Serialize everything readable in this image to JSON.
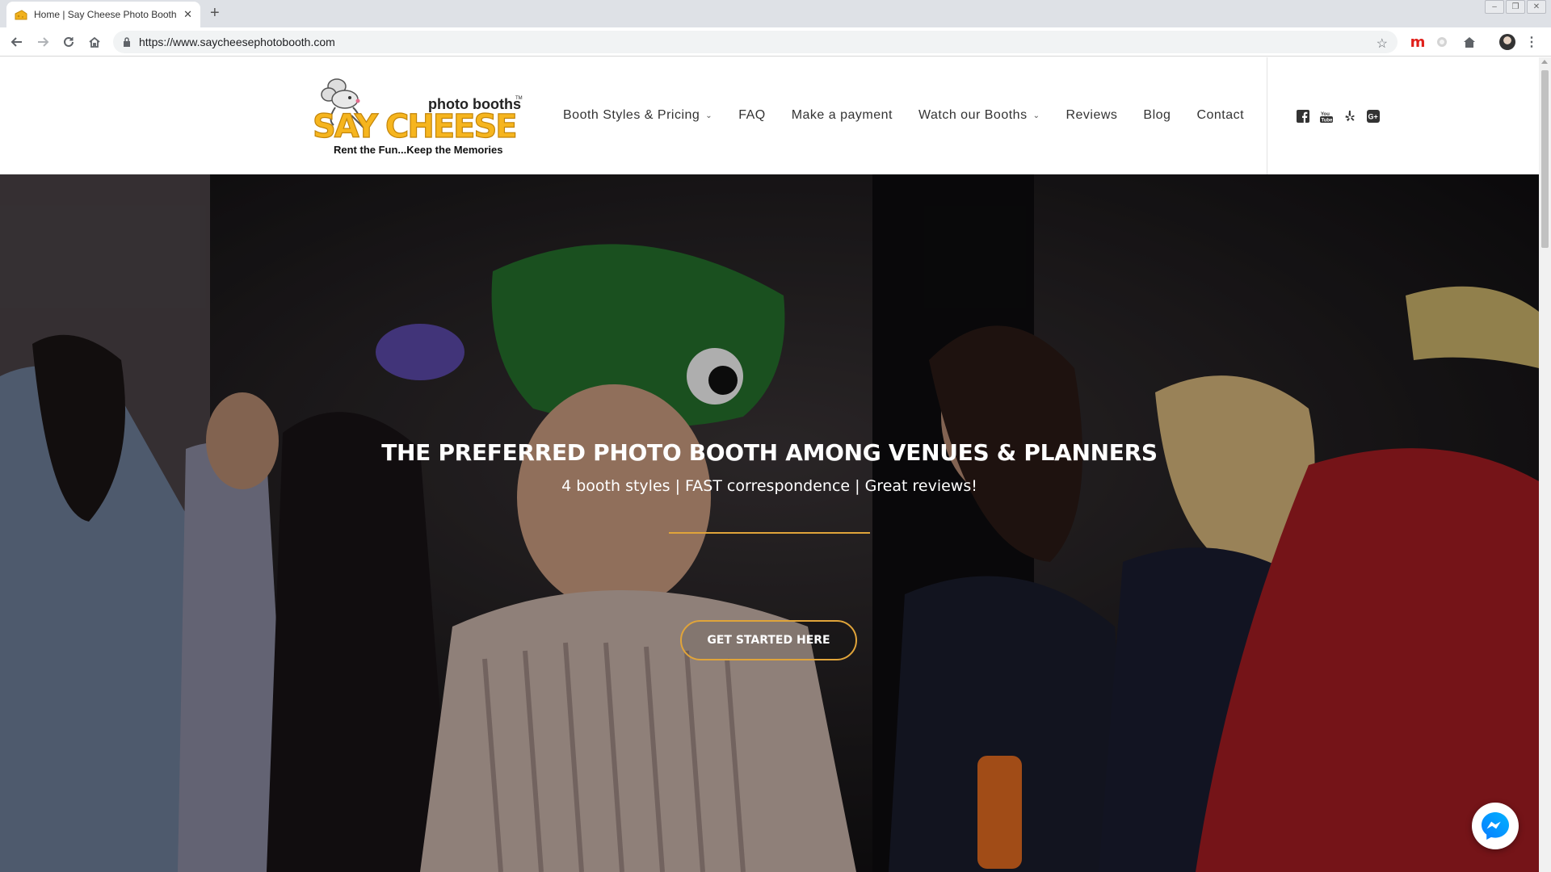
{
  "browser": {
    "tab_title": "Home | Say Cheese Photo Booth Re",
    "url": "https://www.saycheesephotobooth.com",
    "extensions": [
      "m"
    ]
  },
  "site": {
    "logo": {
      "brand_top": "photo booths",
      "brand_main": "SAY CHEESE",
      "tagline": "Rent the Fun...Keep the Memories",
      "tm": "TM"
    },
    "nav": [
      {
        "label": "Booth Styles & Pricing",
        "has_dropdown": true
      },
      {
        "label": "FAQ",
        "has_dropdown": false
      },
      {
        "label": "Make a payment",
        "has_dropdown": false
      },
      {
        "label": "Watch our Booths",
        "has_dropdown": true
      },
      {
        "label": "Reviews",
        "has_dropdown": false
      },
      {
        "label": "Blog",
        "has_dropdown": false
      },
      {
        "label": "Contact",
        "has_dropdown": false
      }
    ],
    "social_icons": [
      "facebook-icon",
      "youtube-icon",
      "yelp-icon",
      "google-plus-icon"
    ]
  },
  "hero": {
    "title": "THE PREFERRED PHOTO BOOTH AMONG VENUES & PLANNERS",
    "subtitle": "4 booth styles | FAST correspondence | Great reviews!",
    "cta_label": "GET STARTED HERE"
  },
  "colors": {
    "accent": "#e0a43a",
    "logo_yellow": "#f6b51e"
  }
}
